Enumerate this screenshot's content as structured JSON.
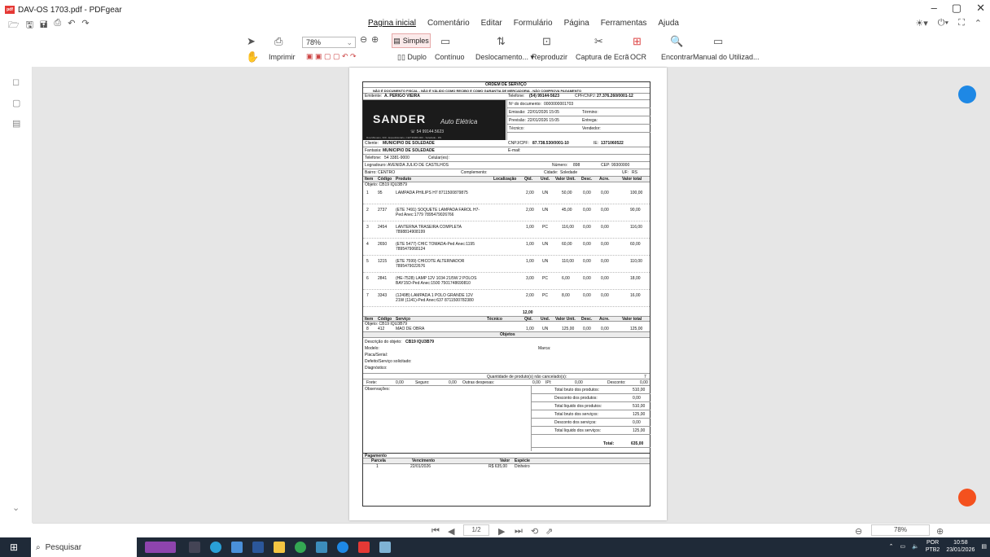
{
  "titlebar": {
    "title": "DAV-OS 1703.pdf - PDFgear",
    "logo": "pdf"
  },
  "menus": [
    {
      "label": "Pagina inicial"
    },
    {
      "label": "Comentário"
    },
    {
      "label": "Editar"
    },
    {
      "label": "Formulário"
    },
    {
      "label": "Página"
    },
    {
      "label": "Ferramentas"
    },
    {
      "label": "Ajuda"
    }
  ],
  "ribbon": {
    "zoom": "78%",
    "imprimir": "Imprimir",
    "simples": "Simples",
    "duplo": "Duplo",
    "continuo": "Contínuo",
    "deslocamento": "Deslocamento...",
    "reproduzir": "Reproduzir",
    "captura": "Captura de Ecrã",
    "ocr": "OCR",
    "encontrar": "Encontrar",
    "manual": "Manual do Utilizad..."
  },
  "doc": {
    "title": "ORDEM DE SERVIÇO",
    "disclaimer": "NÃO É DOCUMENTO FISCAL - NÃO É VÁLIDO COMO RECIBO E COMO GARANTIA DE MERCADORIA - NÃO COMPROVA PAGAMENTO",
    "emitente_label": "Emitente:",
    "emitente": "A. PERIGO VIEIRA",
    "telefone_label": "Telefone:",
    "telefone": "(54) 99144-5623",
    "cpfcnpj_label": "CPF/CNPJ:",
    "cpfcnpj": "27.376.260/0001-12",
    "banner_name": "SANDER",
    "banner_sub": "Auto Elétrica",
    "banner_phone": "☏ 54 99144.5623",
    "banner_addr": "Rua Minuano, 330 - Expedicionário, CEP 99300-000 - Soledade - RS",
    "ndoc_label": "Nº do documento:",
    "ndoc": "0000000001703",
    "emissao_label": "Emissão:",
    "emissao": "22/01/2026 15:05",
    "termino_label": "Término:",
    "previsao_label": "Previsão:",
    "previsao": "22/01/2026 15:05",
    "entrega_label": "Entrega:",
    "tecnico_label": "Técnico:",
    "vendedor_label": "Vendedor:",
    "cliente_label": "Cliente:",
    "cliente": "MUNICIPIO DE SOLEDADE",
    "cnpj_label": "CNPJ/CPF:",
    "cnpj": "87.738.530/0001-10",
    "ie_label": "IE:",
    "ie": "1371060522",
    "fantasia_label": "Fantasia:",
    "fantasia": "MUNICIPIO DE SOLEDADE",
    "email_label": "E-mail:",
    "fone_label": "Telefone:",
    "fone": "54 3381-9000",
    "celular_label": "Celular(es):",
    "logradouro_label": "Logradouro:",
    "logradouro": "AVENIDA JULIO DE CASTILHOS",
    "numero_label": "Número:",
    "numero": "898",
    "cep_label": "CEP:",
    "cep": "99300000",
    "bairro_label": "Bairro:",
    "bairro": "CENTRO",
    "complemento_label": "Complemento:",
    "cidade_label": "Cidade:",
    "cidade": "Soledade",
    "uf_label": "UF:",
    "uf": "RS",
    "prod_headers": [
      "Item",
      "Código",
      "Produto",
      "Localização",
      "Qtd.",
      "Und.",
      "Valor Unit.",
      "Desc.",
      "Acre.",
      "Valor total"
    ],
    "objeto": "Objeto: CB19 IQU3B79",
    "products": [
      {
        "item": "1",
        "code": "95",
        "desc": "LAMPADA PHILIPS H7 8711500879875",
        "desc2": "",
        "qtd": "2,00",
        "und": "UN",
        "unit": "50,00",
        "desc_v": "0,00",
        "acre": "0,00",
        "total": "100,00"
      },
      {
        "item": "2",
        "code": "2737",
        "desc": "(ETE 7491) SOQUETE LAMPADA FAROL H7-",
        "desc2": "Ped Anec:1779 7895479026766",
        "qtd": "2,00",
        "und": "UN",
        "unit": "45,00",
        "desc_v": "0,00",
        "acre": "0,00",
        "total": "90,00"
      },
      {
        "item": "3",
        "code": "2454",
        "desc": "LANTERNA TRASEIRA COMPLETA",
        "desc2": "7898814908199",
        "qtd": "1,00",
        "und": "PC",
        "unit": "116,00",
        "desc_v": "0,00",
        "acre": "0,00",
        "total": "116,00"
      },
      {
        "item": "4",
        "code": "2650",
        "desc": "(ETE 5477) CHIC TOMADA-Ped Anec:1195",
        "desc2": "7895479068124",
        "qtd": "1,00",
        "und": "UN",
        "unit": "60,00",
        "desc_v": "0,00",
        "acre": "0,00",
        "total": "60,00"
      },
      {
        "item": "5",
        "code": "1215",
        "desc": "(ETE 7599) CHICOTE ALTERNADOR",
        "desc2": "7895479022676",
        "qtd": "1,00",
        "und": "UN",
        "unit": "110,00",
        "desc_v": "0,00",
        "acre": "0,00",
        "total": "110,00"
      },
      {
        "item": "6",
        "code": "2841",
        "desc": "(HE-7528) LAMP 12V 1034 21/5W 2 POLOS",
        "desc2": "BAY15D-Ped Anec:1500 7501748690810",
        "qtd": "3,00",
        "und": "PC",
        "unit": "6,00",
        "desc_v": "0,00",
        "acre": "0,00",
        "total": "18,00"
      },
      {
        "item": "7",
        "code": "3343",
        "desc": "(1249B) LAMPADA 1 POLO GRANDE 12V",
        "desc2": "21W (1141)-Ped Anec:637 8711500782380",
        "qtd": "2,00",
        "und": "PC",
        "unit": "8,00",
        "desc_v": "0,00",
        "acre": "0,00",
        "total": "16,00"
      }
    ],
    "prod_qtd_total": "12,00",
    "serv_headers": [
      "Item",
      "Código",
      "Serviço",
      "Técnico",
      "Qtd.",
      "Und.",
      "Valor Unit.",
      "Desc.",
      "Acre.",
      "Valor total"
    ],
    "services": [
      {
        "item": "8",
        "code": "412",
        "desc": "MAO DE OBRA",
        "qtd": "1,00",
        "und": "UN",
        "unit": "125,00",
        "desc_v": "0,00",
        "acre": "0,00",
        "total": "125,00"
      }
    ],
    "objetos_label": "Objetos",
    "descricao_label": "Descrição do objeto:",
    "descricao": "CB19 IQU3B79",
    "modelo_label": "Modelo:",
    "marca_label": "Marca:",
    "placa_label": "Placa/Serial:",
    "defeito_label": "Defeito/Serviço solicitado:",
    "diagnostico_label": "Diagnóstico:",
    "qtd_cancel_label": "Quantidade de produto(s) não cancelado(s):",
    "qtd_cancel": "7",
    "frete_label": "Frete:",
    "frete": "0,00",
    "seguro_label": "Seguro:",
    "seguro": "0,00",
    "outras_label": "Outras despesas:",
    "outras": "0,00",
    "ipi_label": "IPI:",
    "ipi": "0,00",
    "desconto_label": "Desconto:",
    "desconto": "0,00",
    "obs_label": "Observações:",
    "totals": [
      {
        "label": "Total bruto dos produtos:",
        "value": "510,00"
      },
      {
        "label": "Desconto dos produtos:",
        "value": "0,00"
      },
      {
        "label": "Total liquido dos produtos:",
        "value": "510,00"
      },
      {
        "label": "Total bruto dos serviços:",
        "value": "125,00"
      },
      {
        "label": "Desconto dos serviços:",
        "value": "0,00"
      },
      {
        "label": "Total liquido dos serviços:",
        "value": "125,00"
      }
    ],
    "total_label": "Total:",
    "total": "635,00",
    "pagamento_label": "Pagamento",
    "pay_headers": [
      "Parcela",
      "Vencimento",
      "Valor",
      "Espécie"
    ],
    "payments": [
      {
        "parcela": "1",
        "venc": "22/01/2026",
        "valor": "R$ 635,00",
        "especie": "Dinheiro"
      }
    ]
  },
  "nav": {
    "page": "1/2",
    "zoom": "78%"
  },
  "taskbar": {
    "search": "Pesquisar",
    "lang": "POR",
    "lang2": "PTB2",
    "time": "10:58",
    "date": "23/01/2026"
  },
  "colors": {
    "accent": "#e53935",
    "fab_blue": "#1e88e5",
    "fab_red": "#f4511e",
    "taskbar": "#1f2a38"
  }
}
